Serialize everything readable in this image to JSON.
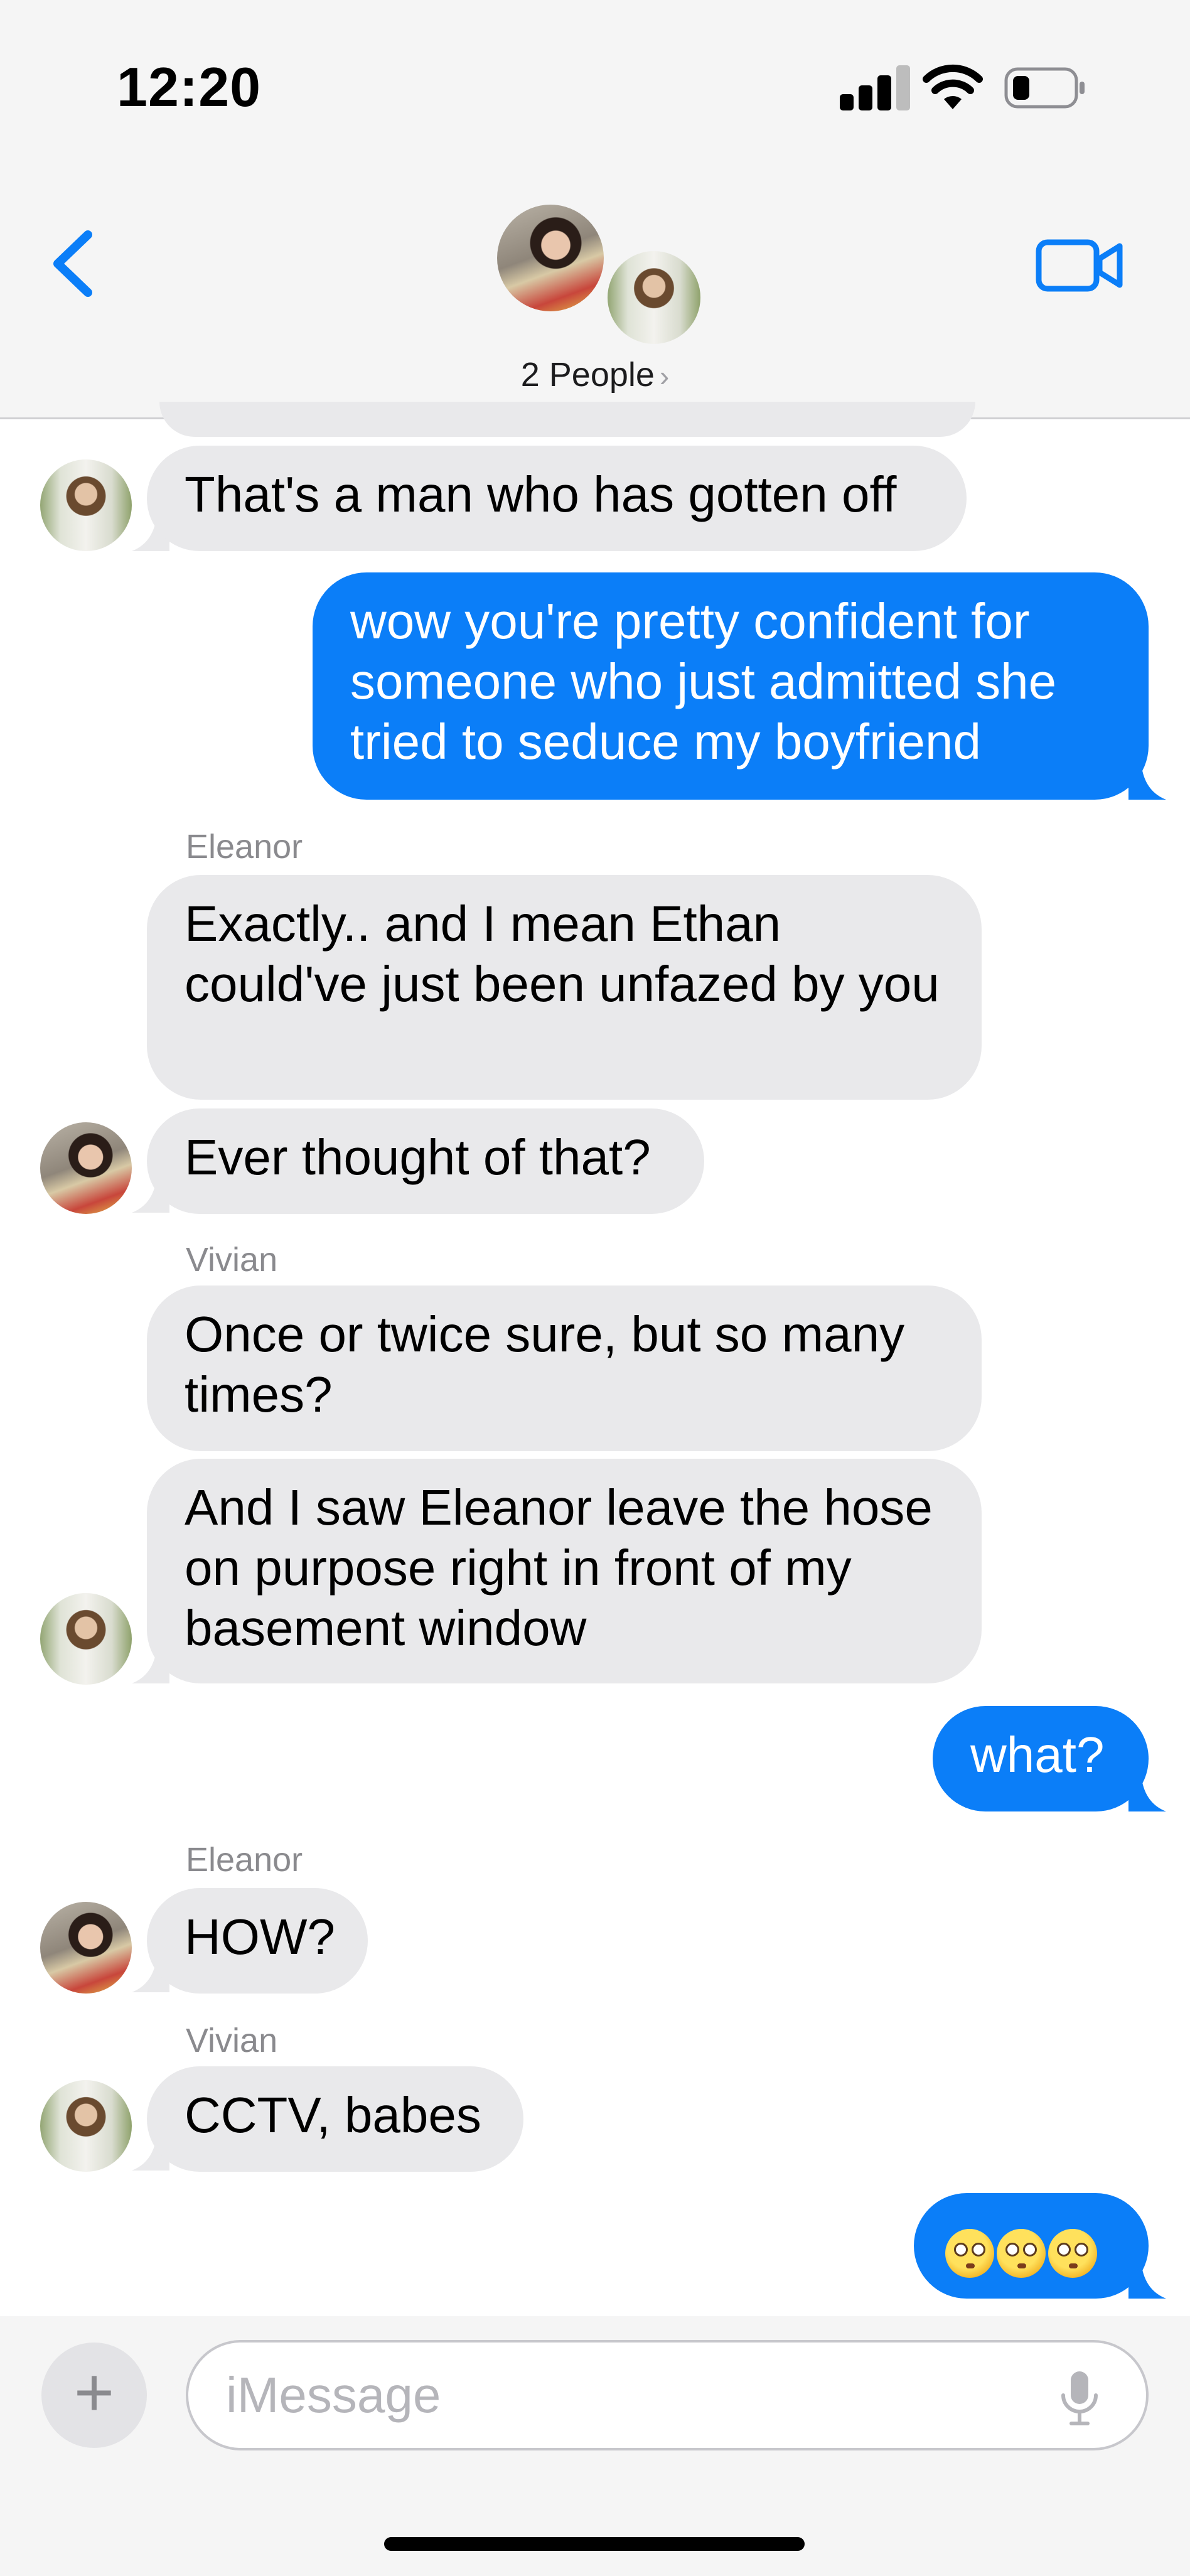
{
  "status_bar": {
    "time": "12:20"
  },
  "header": {
    "people_label": "2 People",
    "chevron": "›"
  },
  "messages": [
    {
      "text": "That's a man who has gotten off"
    },
    {
      "text": "wow you're pretty confident for someone who just admitted she tried to seduce my boyfriend"
    },
    {
      "sender": "Eleanor"
    },
    {
      "text": "Exactly.. and I mean Ethan could've just been unfazed by you"
    },
    {
      "text": "Ever thought of that?"
    },
    {
      "sender": "Vivian"
    },
    {
      "text": "Once or twice sure, but so many times?"
    },
    {
      "text": "And I saw Eleanor leave the hose on purpose right in front of my basement window"
    },
    {
      "text": "what?"
    },
    {
      "sender": "Eleanor"
    },
    {
      "text": "HOW?"
    },
    {
      "sender": "Vivian"
    },
    {
      "text": "CCTV, babes"
    },
    {
      "text": "😳😳😳"
    }
  ],
  "composer": {
    "plus": "+",
    "placeholder": "iMessage"
  },
  "colors": {
    "outgoing": "#0b7ef8",
    "incoming": "#e9e9eb",
    "header_bg": "#f5f5f5"
  },
  "icons": [
    "back-chevron-icon",
    "video-camera-icon",
    "signal-icon",
    "wifi-icon",
    "battery-icon",
    "plus-icon",
    "microphone-icon"
  ]
}
